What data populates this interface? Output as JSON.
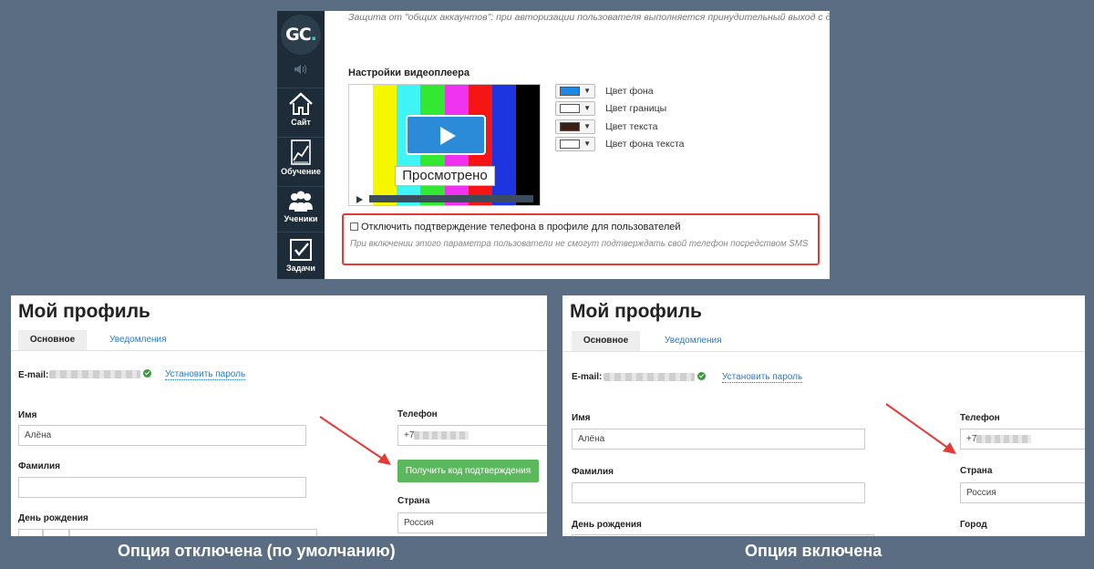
{
  "app": {
    "logo_text": "GC",
    "logo_dot": "."
  },
  "sidebar": {
    "items": [
      {
        "label": "Сайт",
        "icon": "home-icon"
      },
      {
        "label": "Обучение",
        "icon": "chart-icon"
      },
      {
        "label": "Ученики",
        "icon": "users-icon"
      },
      {
        "label": "Задачи",
        "icon": "checkbox-icon"
      }
    ]
  },
  "settings": {
    "notice": "Защита от \"общих аккаунтов\": при авторизации пользователя выполняется принудительный выход с других у",
    "video_player_title": "Настройки видеоплеера",
    "player": {
      "watched_label": "Просмотрено",
      "bars": [
        "#ffffff",
        "#f6f600",
        "#3ff4f4",
        "#33e733",
        "#f033f0",
        "#f51515",
        "#1c35e0",
        "#000000"
      ]
    },
    "colors": [
      {
        "label": "Цвет фона",
        "color": "#1e88e5"
      },
      {
        "label": "Цвет границы",
        "color": "#ffffff"
      },
      {
        "label": "Цвет текста",
        "color": "#3b1f12"
      },
      {
        "label": "Цвет фона текста",
        "color": "#ffffff"
      }
    ],
    "option": {
      "label": "Отключить подтверждение телефона в профиле для пользователей",
      "hint": "При включении этого параметра пользователи не смогут подтверждать свой телефон посредством SMS",
      "checked": false
    }
  },
  "profile_left": {
    "title": "Мой профиль",
    "tab_main": "Основное",
    "tab_notifications": "Уведомления",
    "email_label": "E-mail",
    "set_password": "Установить пароль",
    "name_label": "Имя",
    "name_value": "Алёна",
    "surname_label": "Фамилия",
    "birthday_label": "День рождения",
    "phone_label": "Телефон",
    "phone_prefix": "+7",
    "get_code_button": "Получить код подтверждения",
    "country_label": "Страна",
    "country_value": "Россия"
  },
  "profile_right": {
    "title": "Мой профиль",
    "tab_main": "Основное",
    "tab_notifications": "Уведомления",
    "email_label": "E-mail",
    "set_password": "Установить пароль",
    "name_label": "Имя",
    "name_value": "Алёна",
    "surname_label": "Фамилия",
    "birthday_label": "День рождения",
    "phone_label": "Телефон",
    "phone_prefix": "+7",
    "country_label": "Страна",
    "country_value": "Россия",
    "city_label": "Город"
  },
  "captions": {
    "left": "Опция отключена (по умолчанию)",
    "right": "Опция включена"
  },
  "accent": {
    "highlight_red": "#e53935",
    "button_green": "#5cb85c",
    "link_blue": "#2a7ac8"
  }
}
